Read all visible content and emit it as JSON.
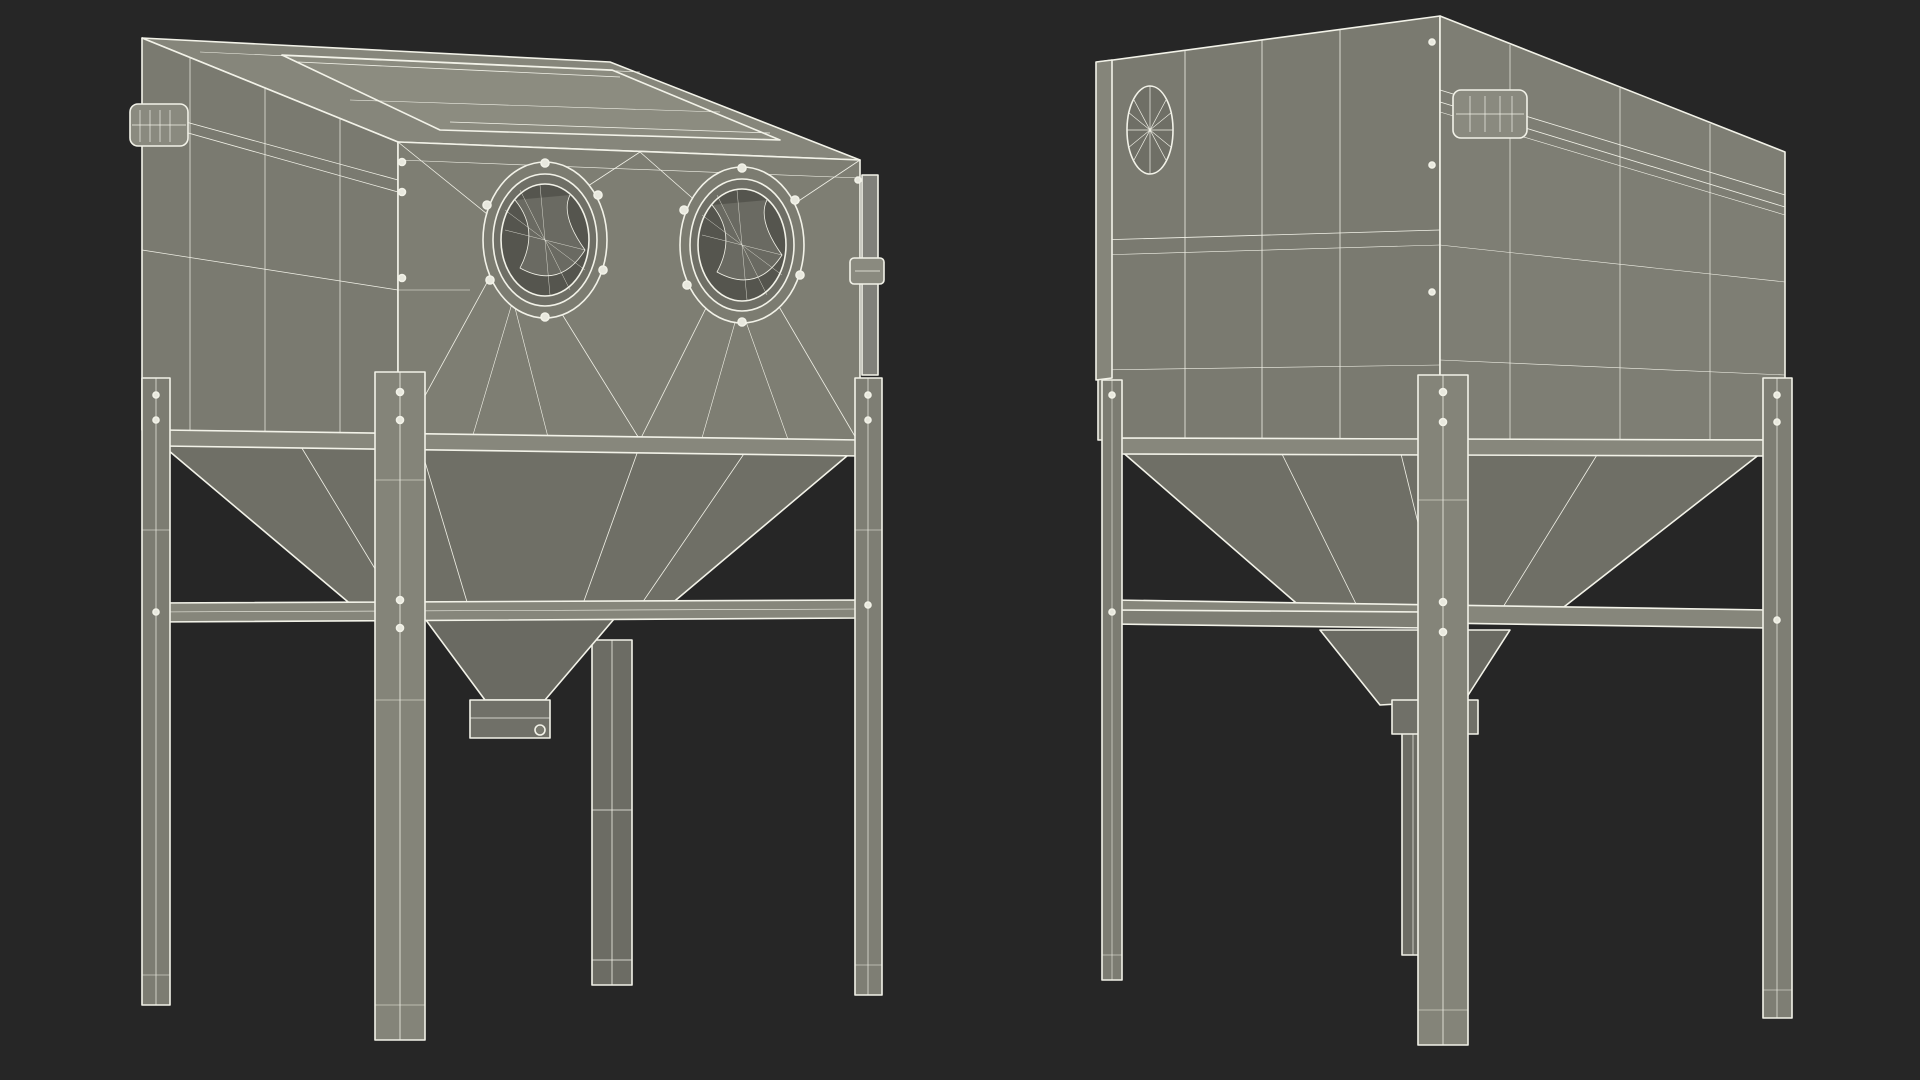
{
  "scene": {
    "background": "#262626",
    "surface_color": "#7a7a70",
    "surface_dark": "#5f5f57",
    "wire_color": "#f2f2e8",
    "views": [
      {
        "name": "front-three-quarter-view",
        "subject": "blast-cabinet",
        "glove_ports": 2
      },
      {
        "name": "rear-three-quarter-view",
        "subject": "blast-cabinet",
        "vent_fans": 1
      }
    ]
  }
}
